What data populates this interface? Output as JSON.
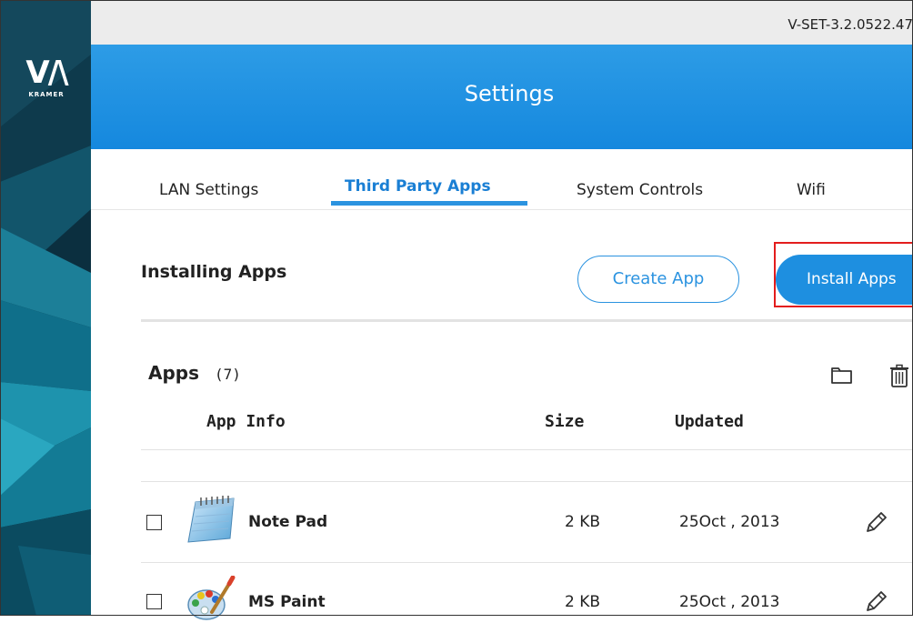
{
  "brand": {
    "logo_text": "V/\\",
    "logo_sub": "KRAMER"
  },
  "version": "V-SET-3.2.0522.47",
  "header": {
    "title": "Settings"
  },
  "tabs": [
    {
      "label": "LAN Settings",
      "active": false
    },
    {
      "label": "Third Party Apps",
      "active": true
    },
    {
      "label": "System Controls",
      "active": false
    },
    {
      "label": "Wifi",
      "active": false
    }
  ],
  "installing": {
    "title": "Installing Apps",
    "create_label": "Create App",
    "install_label": "Install Apps"
  },
  "apps": {
    "title": "Apps",
    "count": "(7)",
    "columns": {
      "info": "App Info",
      "size": "Size",
      "updated": "Updated"
    },
    "rows": [
      {
        "name": "Note Pad",
        "size": "2 KB",
        "updated": "25Oct , 2013",
        "icon": "notepad-icon"
      },
      {
        "name": "MS Paint",
        "size": "2 KB",
        "updated": "25Oct , 2013",
        "icon": "paint-palette-icon"
      }
    ]
  },
  "colors": {
    "accent": "#1e8fe0",
    "highlight": "#e31d1d",
    "sidebar": "#0b2f3f"
  }
}
